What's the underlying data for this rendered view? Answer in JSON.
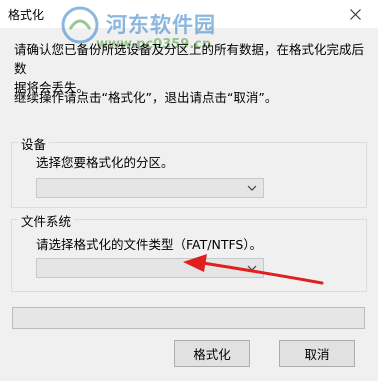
{
  "window": {
    "title": "格式化"
  },
  "watermark": {
    "brand": "河东软件园",
    "url": "www.pc0359.cn"
  },
  "message": {
    "line1": "请确认您已备份所选设备及分区上的所有数据，在格式化完成后数",
    "line2": "据将会丢失。",
    "line3": "继续操作请点击“格式化”，退出请点击“取消”。"
  },
  "device_group": {
    "legend": "设备",
    "prompt": "选择您要格式化的分区。",
    "combo_value": ""
  },
  "fs_group": {
    "legend": "文件系统",
    "prompt": "请选择格式化的文件类型（FAT/NTFS）。",
    "combo_value": ""
  },
  "progress": {
    "value": 0
  },
  "buttons": {
    "format": "格式化",
    "cancel": "取消"
  },
  "icons": {
    "close": "close-icon",
    "chevron": "chevron-down-icon",
    "annotation": "red-arrow-annotation"
  },
  "colors": {
    "annotation": "#e02020",
    "watermark_blue": "#2e7fc9",
    "watermark_green": "#4b9a3a"
  }
}
